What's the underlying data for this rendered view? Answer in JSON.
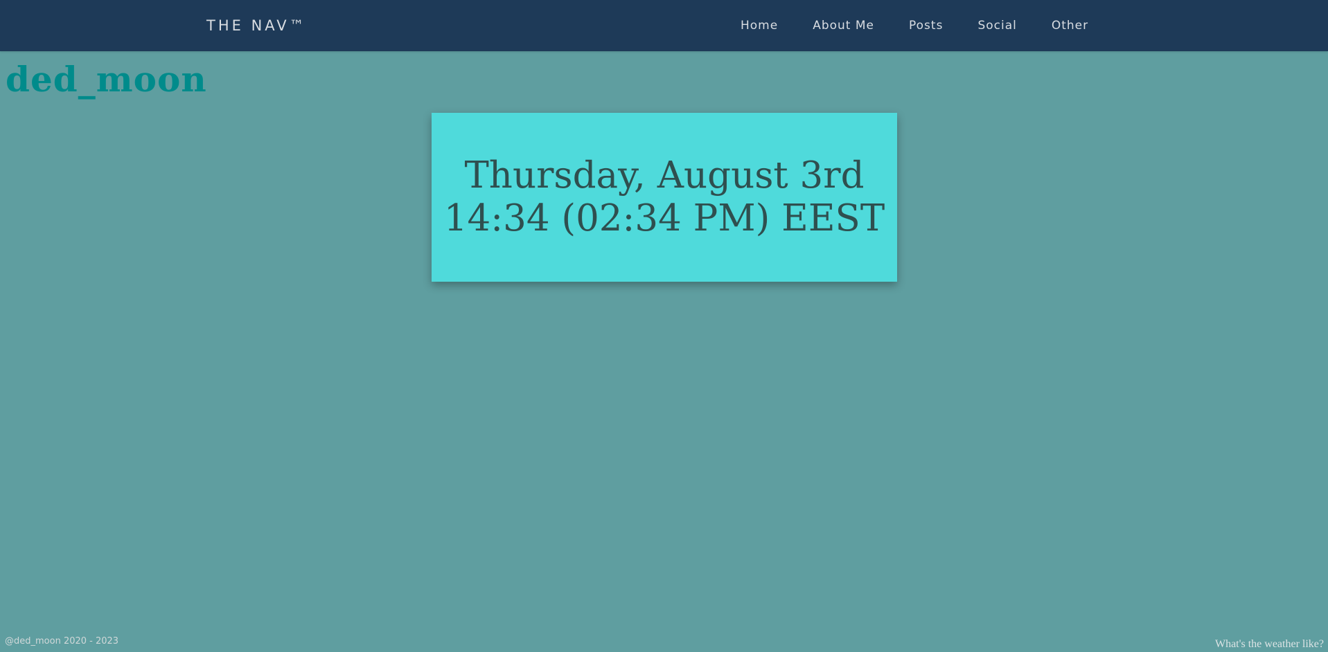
{
  "navbar": {
    "brand": "THE NAV™",
    "links": [
      "Home",
      "About Me",
      "Posts",
      "Social",
      "Other"
    ]
  },
  "site": {
    "title": "ded_moon"
  },
  "datetime": {
    "date": "Thursday, August 3rd",
    "time": "14:34 (02:34 PM) EEST"
  },
  "footer": {
    "copyright": "@ded_moon 2020 - 2023",
    "weather_link": "What's the weather like?"
  },
  "colors": {
    "background": "#5f9ea0",
    "navbar": "#1e3a58",
    "card": "#4fdadb",
    "title": "#008b8b",
    "card_text": "#2f4f4f"
  }
}
